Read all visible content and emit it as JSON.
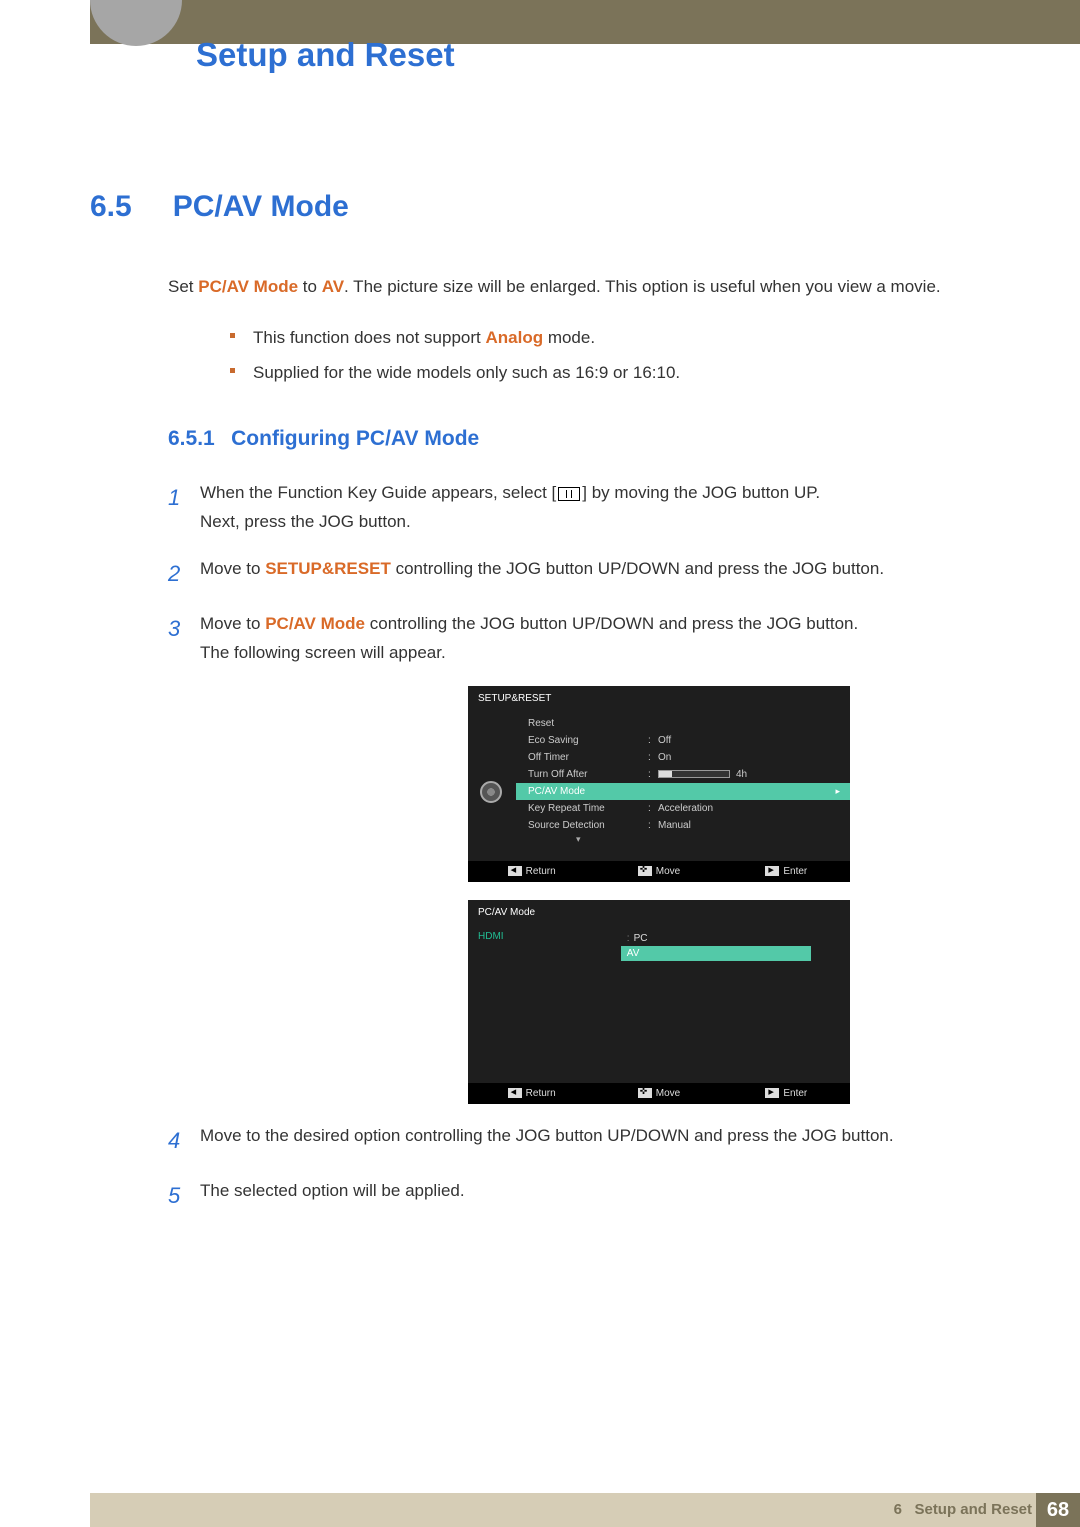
{
  "chapter_title": "Setup and Reset",
  "section": {
    "num": "6.5",
    "title": "PC/AV Mode"
  },
  "intro": {
    "pre": "Set ",
    "bold1": "PC/AV Mode",
    "mid": " to ",
    "bold2": "AV",
    "post": ". The picture size will be enlarged. This option is useful when you view a movie."
  },
  "bullets": [
    {
      "pre": "This function does not support ",
      "bold": "Analog",
      "post": " mode."
    },
    {
      "text": "Supplied for the wide models only such as 16:9 or 16:10."
    }
  ],
  "subsection": {
    "num": "6.5.1",
    "title": "Configuring PC/AV Mode"
  },
  "steps": {
    "s1": {
      "num": "1",
      "t1": "When the Function Key Guide appears, select ",
      "br_open": "[",
      "br_close": "]",
      "t2": " by moving the JOG button UP.",
      "t3": "Next, press the JOG button."
    },
    "s2": {
      "num": "2",
      "t1": "Move to ",
      "bold": "SETUP&RESET",
      "t2": " controlling the JOG button UP/DOWN and press the JOG button."
    },
    "s3": {
      "num": "3",
      "t1": "Move to ",
      "bold": "PC/AV Mode",
      "t2": " controlling the JOG button UP/DOWN and press the JOG button.",
      "t3": "The following screen will appear."
    },
    "s4": {
      "num": "4",
      "text": "Move to the desired option controlling the JOG button UP/DOWN and press the JOG button."
    },
    "s5": {
      "num": "5",
      "text": "The selected option will be applied."
    }
  },
  "osd1": {
    "title": "SETUP&RESET",
    "rows": [
      {
        "label": "Reset",
        "value": ""
      },
      {
        "label": "Eco Saving",
        "value": "Off"
      },
      {
        "label": "Off Timer",
        "value": "On"
      },
      {
        "label": "Turn Off After",
        "value": "4h",
        "slider": true
      },
      {
        "label": "PC/AV Mode",
        "value": "",
        "hl": true,
        "arrow": "▸"
      },
      {
        "label": "Key Repeat Time",
        "value": "Acceleration"
      },
      {
        "label": "Source Detection",
        "value": "Manual"
      }
    ],
    "down": "▾",
    "foot": {
      "ret": "Return",
      "mov": "Move",
      "ent": "Enter"
    }
  },
  "osd2": {
    "title": "PC/AV Mode",
    "input": "HDMI",
    "opts": [
      {
        "label": "PC",
        "sep": ":"
      },
      {
        "label": "AV",
        "sel": true
      }
    ],
    "foot": {
      "ret": "Return",
      "mov": "Move",
      "ent": "Enter"
    }
  },
  "footer": {
    "chapter_num": "6",
    "chapter_text": "Setup and Reset",
    "page": "68"
  }
}
